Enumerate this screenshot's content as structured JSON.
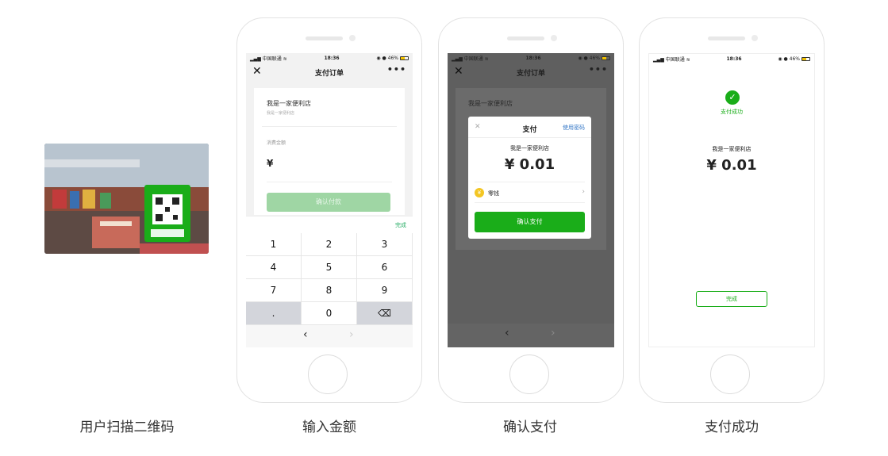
{
  "steps": [
    {
      "caption": "用户扫描二维码"
    },
    {
      "caption": "输入金额"
    },
    {
      "caption": "确认支付"
    },
    {
      "caption": "支付成功"
    }
  ],
  "status_bar": {
    "carrier": "中国联通",
    "time": "18:36",
    "battery": "46%"
  },
  "screen_input": {
    "nav_title": "支付订单",
    "merchant": "我是一家便利店",
    "merchant_sub": "我是一家便利店",
    "amount_label": "消费金额",
    "currency": "¥",
    "confirm_button": "确认付款",
    "keypad_done": "完成",
    "keys": [
      "1",
      "2",
      "3",
      "4",
      "5",
      "6",
      "7",
      "8",
      "9",
      ".",
      "0",
      "⌫"
    ]
  },
  "screen_confirm": {
    "nav_title": "支付订单",
    "merchant_behind": "我是一家便利店",
    "modal_title": "支付",
    "use_password": "使用密码",
    "merchant": "我是一家便利店",
    "amount": "¥ 0.01",
    "method": "零钱",
    "pay_button": "确认支付"
  },
  "screen_success": {
    "title": "支付成功",
    "merchant": "我是一家便利店",
    "amount": "¥ 0.01",
    "done_button": "完成"
  },
  "colors": {
    "wechat_green": "#1aad19",
    "link_blue": "#3a7bc8"
  }
}
